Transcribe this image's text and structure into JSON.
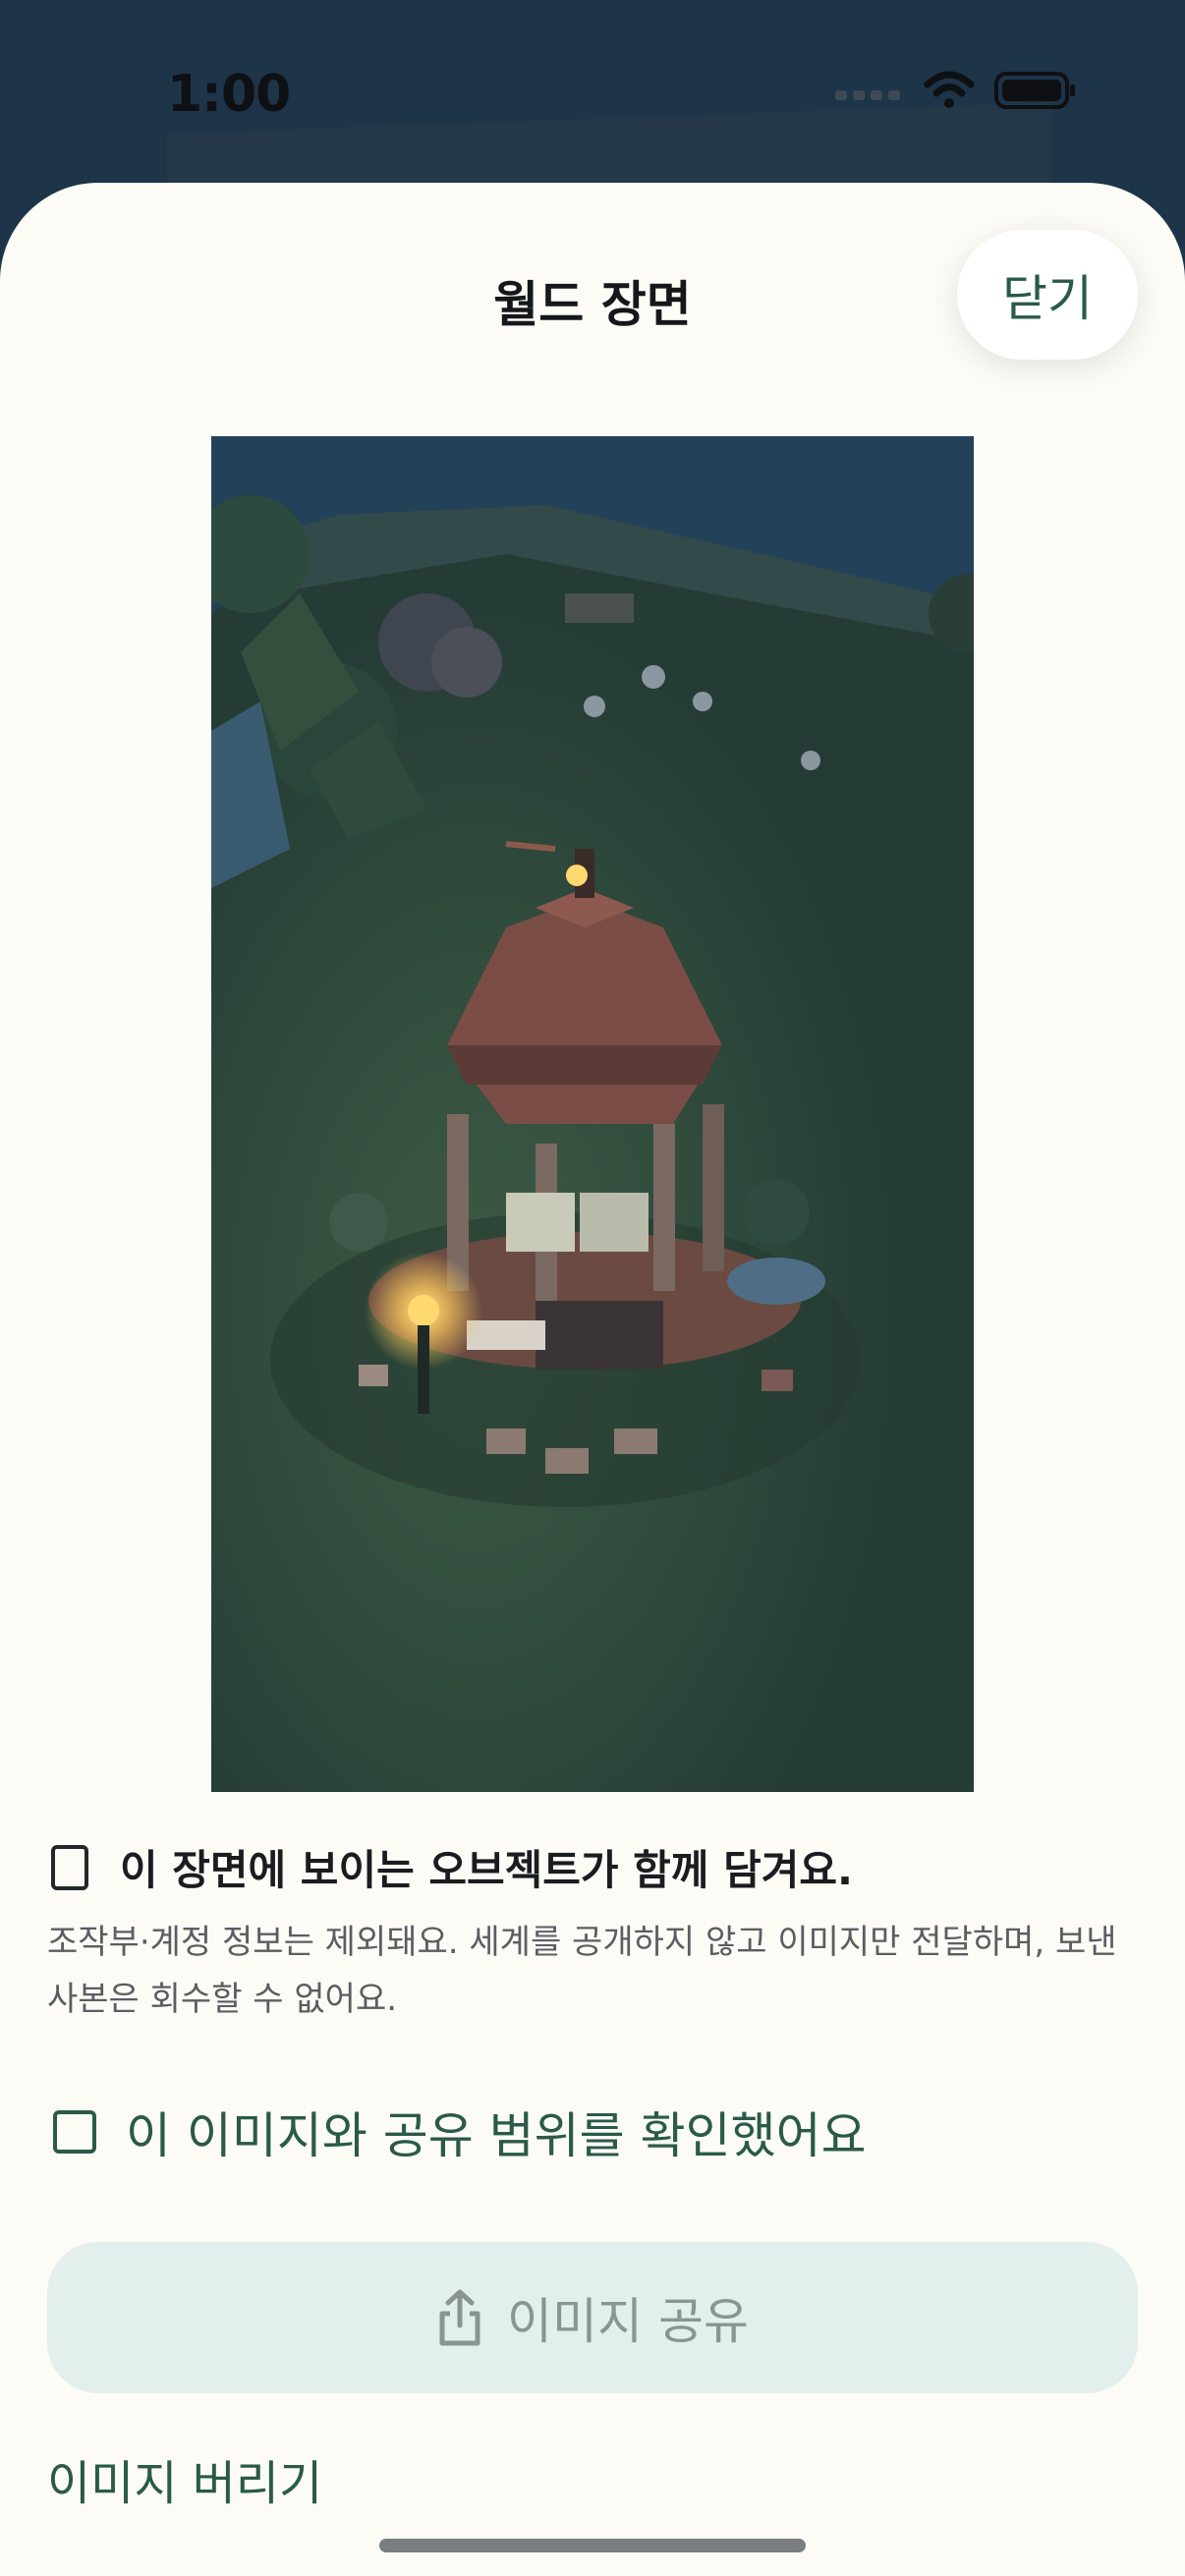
{
  "status_bar": {
    "time": "1:00",
    "icons": [
      "signal-icon",
      "wifi-icon",
      "battery-icon"
    ]
  },
  "sheet": {
    "title": "월드 장면",
    "close_label": "닫기"
  },
  "scene_image": {
    "description_icon": "gazebo-scene-image"
  },
  "notice": {
    "title": "이 장면에 보이는 오브젝트가 함께 담겨요.",
    "description": "조작부·계정 정보는 제외돼요. 세계를 공개하지 않고 이미지만 전달하며, 보낸 사본은 회수할 수 없어요.",
    "checked": false
  },
  "confirm": {
    "label": "이 이미지와 공유 범위를 확인했어요",
    "checked": false
  },
  "share_button": {
    "label": "이미지 공유",
    "icon": "share-icon",
    "enabled": false
  },
  "discard_link": {
    "label": "이미지 버리기"
  },
  "colors": {
    "accent": "#2a5a48",
    "sheet_bg": "#fcfbf6",
    "button_disabled_bg": "#e3efec"
  }
}
